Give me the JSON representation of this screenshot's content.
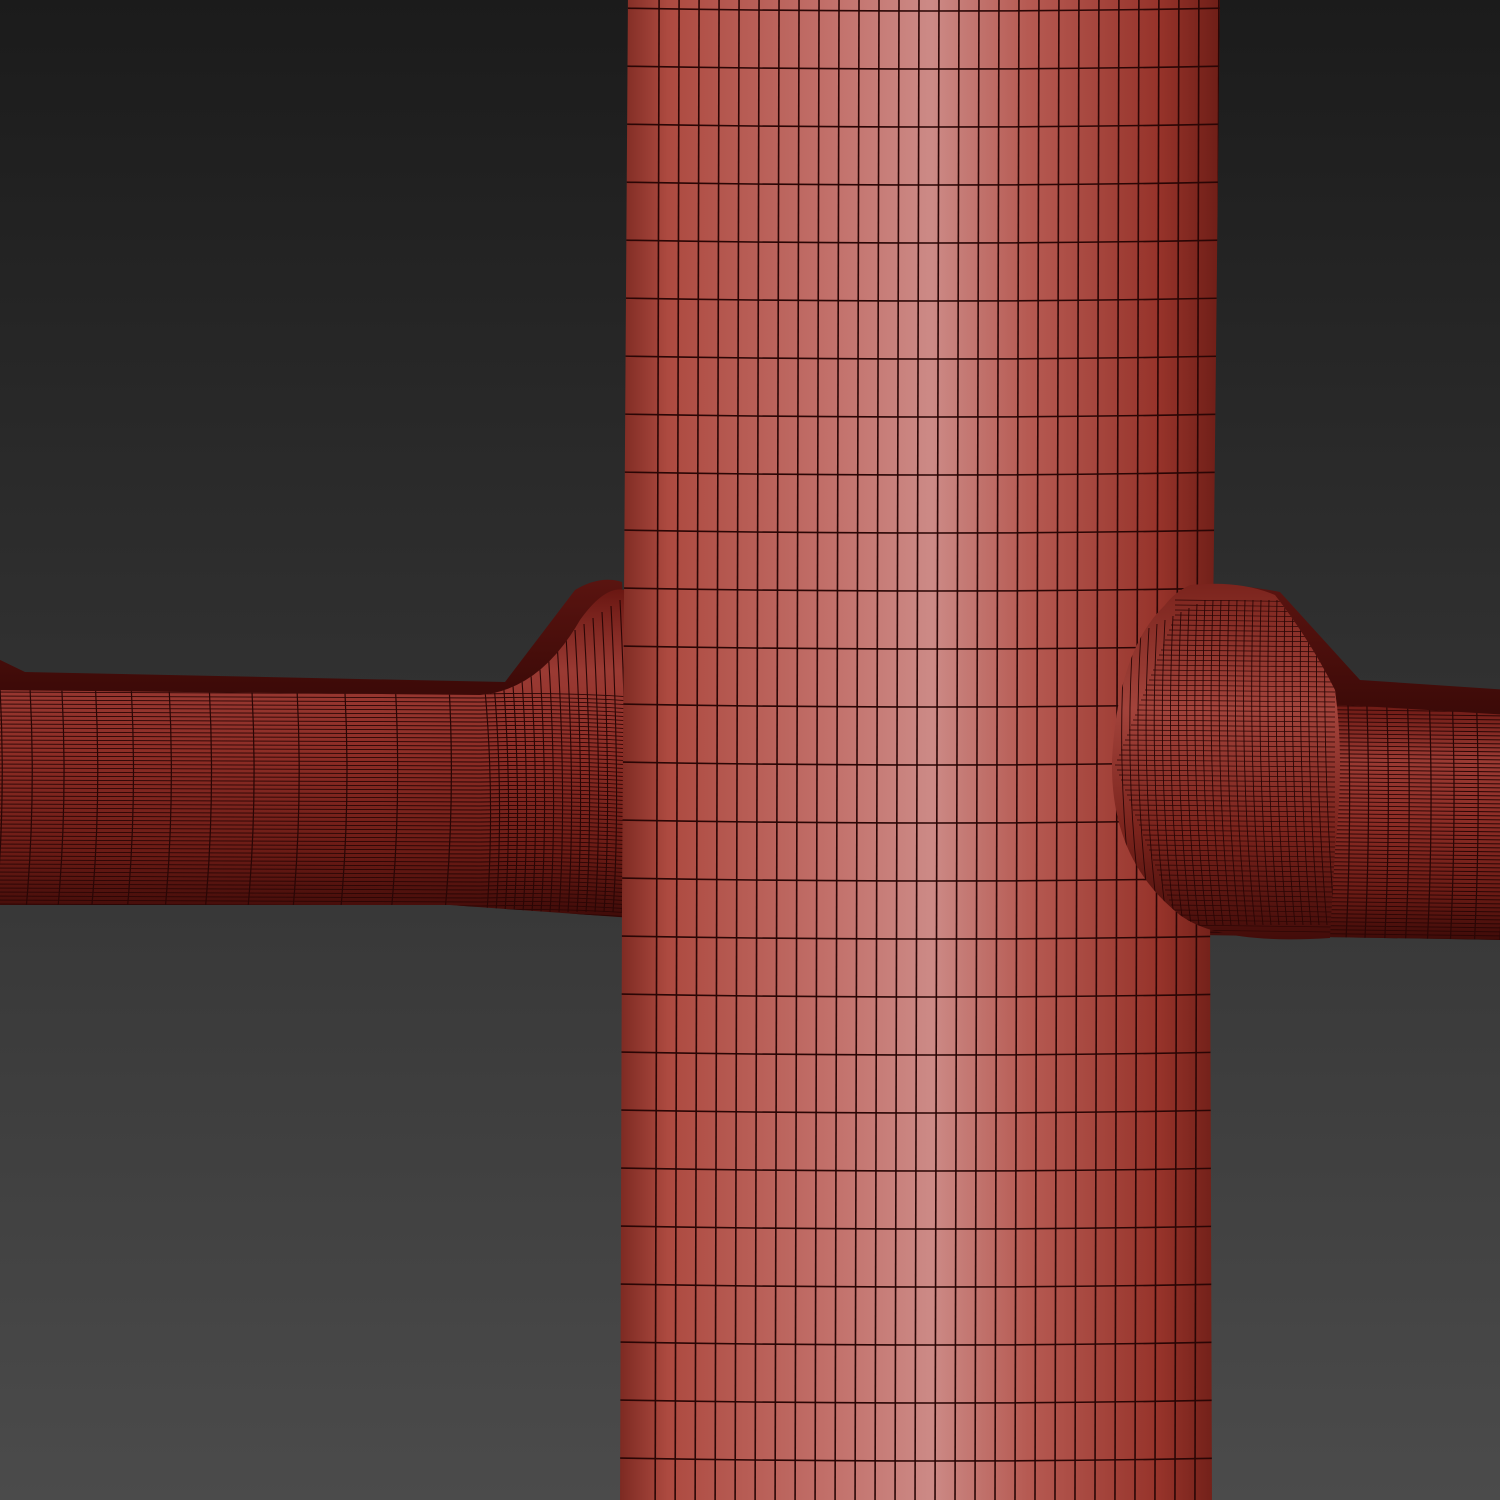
{
  "viewport": {
    "background_top": "#1b1b1b",
    "background_bottom": "#4b4b4b"
  },
  "mesh": {
    "base_color": "#b84a42",
    "dark_color": "#4a0d0b",
    "highlight_color": "#c98581",
    "wire_color": "#2a0605"
  }
}
